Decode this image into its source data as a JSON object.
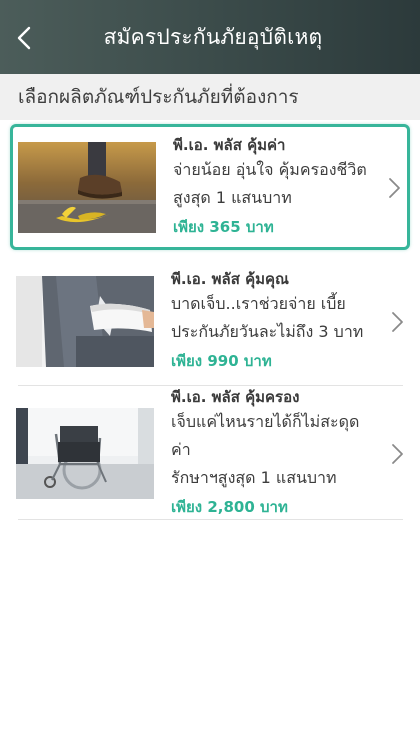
{
  "header": {
    "title": "สมัครประกันภัยอุบัติเหตุ",
    "back_icon": "chevron-left-icon"
  },
  "subheader": {
    "text": "เลือกผลิตภัณฑ์ประกันภัยที่ต้องการ"
  },
  "accent_color": "#37b59a",
  "products": [
    {
      "name": "พี.เอ. พลัส คุ้มค่า",
      "desc_line1": "จ่ายน้อย อุ่นใจ คุ้มครองชีวิต",
      "desc_line2": "สูงสุด 1 แสนบาท",
      "price": "เพียง 365 บาท",
      "image": "banana-peel-slip-photo",
      "selected": true
    },
    {
      "name": "พี.เอ. พลัส คุ้มคุณ",
      "desc_line1": "บาดเจ็บ..เราช่วยจ่าย เบี้ย",
      "desc_line2": "ประกันภัยวันละไม่ถึง 3 บาท",
      "price": "เพียง 990 บาท",
      "image": "arm-sling-photo",
      "selected": false
    },
    {
      "name": "พี.เอ. พลัส คุ้มครอง",
      "desc_line1": "เจ็บแค่ไหนรายได้ก็ไม่สะดุด ค่า",
      "desc_line2": "รักษาฯสูงสุด 1 แสนบาท",
      "price": "เพียง 2,800 บาท",
      "image": "wheelchair-photo",
      "selected": false
    }
  ]
}
